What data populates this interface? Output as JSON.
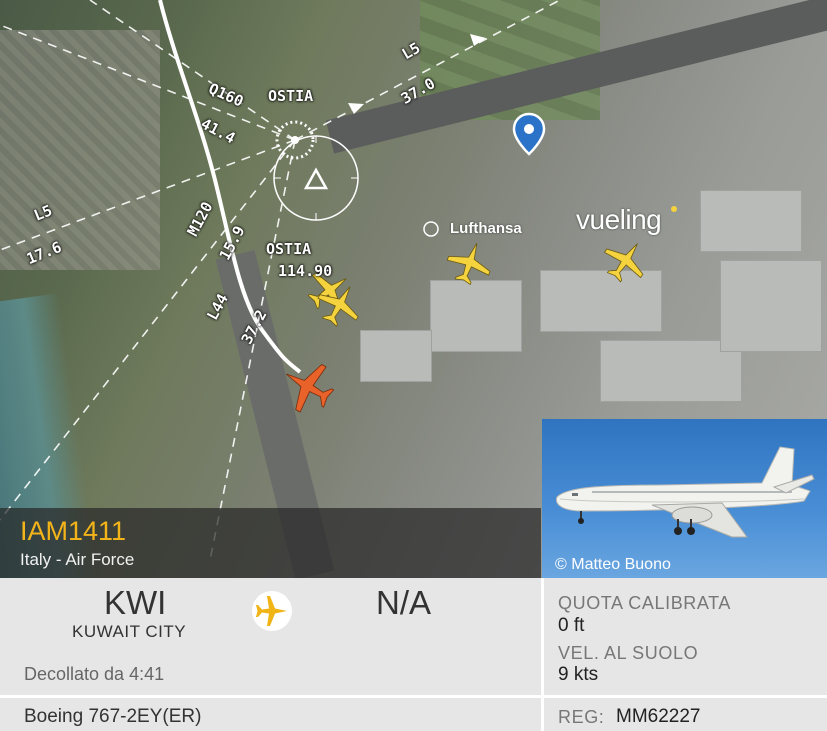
{
  "map": {
    "labels": {
      "q160": "Q160",
      "ostia_top": "OSTIA",
      "l5_right": "L5",
      "val_37_0": "37.0",
      "val_41_4": "41.4",
      "l5_left": "L5",
      "val_17_6": "17.6",
      "m120": "M120",
      "val_15_9": "15.9",
      "ostia_freq_name": "OSTIA",
      "ostia_freq": "114.90",
      "l44": "L44",
      "val_37_2": "37.2"
    },
    "brands": {
      "lufthansa": "Lufthansa",
      "vueling": "vueling"
    }
  },
  "flight": {
    "callsign": "IAM1411",
    "operator": "Italy - Air Force",
    "photo_credit": "© Matteo Buono"
  },
  "route": {
    "origin_code": "KWI",
    "origin_city": "KUWAIT CITY",
    "destination_code": "N/A",
    "departed_text": "Decollato da 4:41"
  },
  "aircraft": {
    "model": "Boeing 767-2EY(ER)"
  },
  "stats": {
    "altitude_label": "QUOTA CALIBRATA",
    "altitude_value": "0 ft",
    "speed_label": "VEL. AL SUOLO",
    "speed_value": "9 kts",
    "reg_label": "REG:",
    "reg_value": "MM62227"
  },
  "colors": {
    "accent": "#f3b41a",
    "selected_plane": "#e8622a",
    "other_planes": "#f4d33f",
    "pin": "#2a73c8"
  }
}
